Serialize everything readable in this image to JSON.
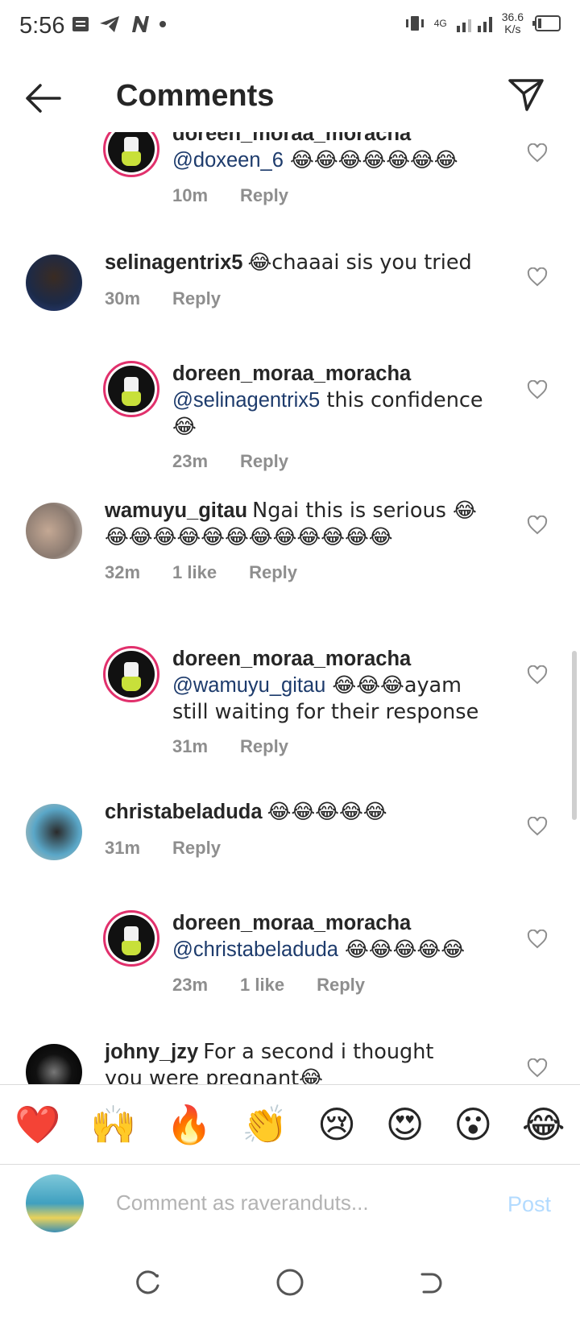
{
  "status": {
    "time": "5:56",
    "network": "4G",
    "speed": "36.6",
    "speed_unit": "K/s"
  },
  "header": {
    "title": "Comments"
  },
  "comments": [
    {
      "user": "doreen_moraa_moracha",
      "mention": "@doxeen_6",
      "text": " 😂😂😂😂😂😂😂",
      "time": "10m",
      "likes": "",
      "reply": "Reply",
      "avatar_color": "#111111"
    },
    {
      "user": "selinagentrix5",
      "mention": "",
      "text": "😂chaaai sis you tried",
      "time": "30m",
      "likes": "",
      "reply": "Reply",
      "avatar_color": "#2b3a55"
    },
    {
      "user": "doreen_moraa_moracha",
      "mention": "@selinagentrix5",
      "text": " this confidence 😂",
      "time": "23m",
      "likes": "",
      "reply": "Reply",
      "avatar_color": "#111111"
    },
    {
      "user": "wamuyu_gitau",
      "mention": "",
      "text": "Ngai this is serious 😂😂😂😂😂😂😂😂😂😂😂😂😂",
      "time": "32m",
      "likes": "1 like",
      "reply": "Reply",
      "avatar_color": "#9a8e86"
    },
    {
      "user": "doreen_moraa_moracha",
      "mention": "@wamuyu_gitau",
      "text": " 😂😂😂ayam still waiting for their response",
      "time": "31m",
      "likes": "",
      "reply": "Reply",
      "avatar_color": "#111111"
    },
    {
      "user": "christabeladuda",
      "mention": "",
      "text": "😂😂😂😂😂",
      "time": "31m",
      "likes": "",
      "reply": "Reply",
      "avatar_color": "#5aa7c8"
    },
    {
      "user": "doreen_moraa_moracha",
      "mention": "@christabeladuda",
      "text": " 😂😂😂😂😂",
      "time": "23m",
      "likes": "1 like",
      "reply": "Reply",
      "avatar_color": "#111111"
    },
    {
      "user": "johny_jzy",
      "mention": "",
      "text": "For a second i thought you were pregnant😂",
      "time": "",
      "likes": "",
      "reply": "",
      "avatar_color": "#111111"
    }
  ],
  "emoji_bar": [
    "❤️",
    "🙌",
    "🔥",
    "👏",
    "😢",
    "😍",
    "😮",
    "😂"
  ],
  "composer": {
    "placeholder": "Comment as raveranduts...",
    "post": "Post"
  }
}
